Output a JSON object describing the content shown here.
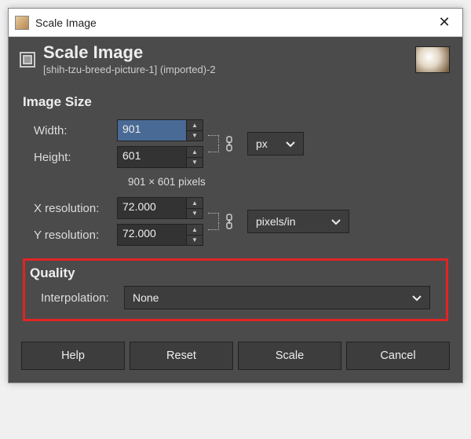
{
  "titlebar": {
    "title": "Scale Image"
  },
  "header": {
    "title": "Scale Image",
    "subtitle": "[shih-tzu-breed-picture-1] (imported)-2"
  },
  "image_size": {
    "heading": "Image Size",
    "width_label": "Width:",
    "height_label": "Height:",
    "width": "901",
    "height": "601",
    "pixel_note": "901 × 601 pixels",
    "xres_label": "X resolution:",
    "yres_label": "Y resolution:",
    "xres": "72.000",
    "yres": "72.000",
    "size_unit": "px",
    "res_unit": "pixels/in"
  },
  "quality": {
    "heading": "Quality",
    "interp_label": "Interpolation:",
    "interp_value": "None"
  },
  "buttons": {
    "help": "Help",
    "reset": "Reset",
    "scale": "Scale",
    "cancel": "Cancel"
  }
}
